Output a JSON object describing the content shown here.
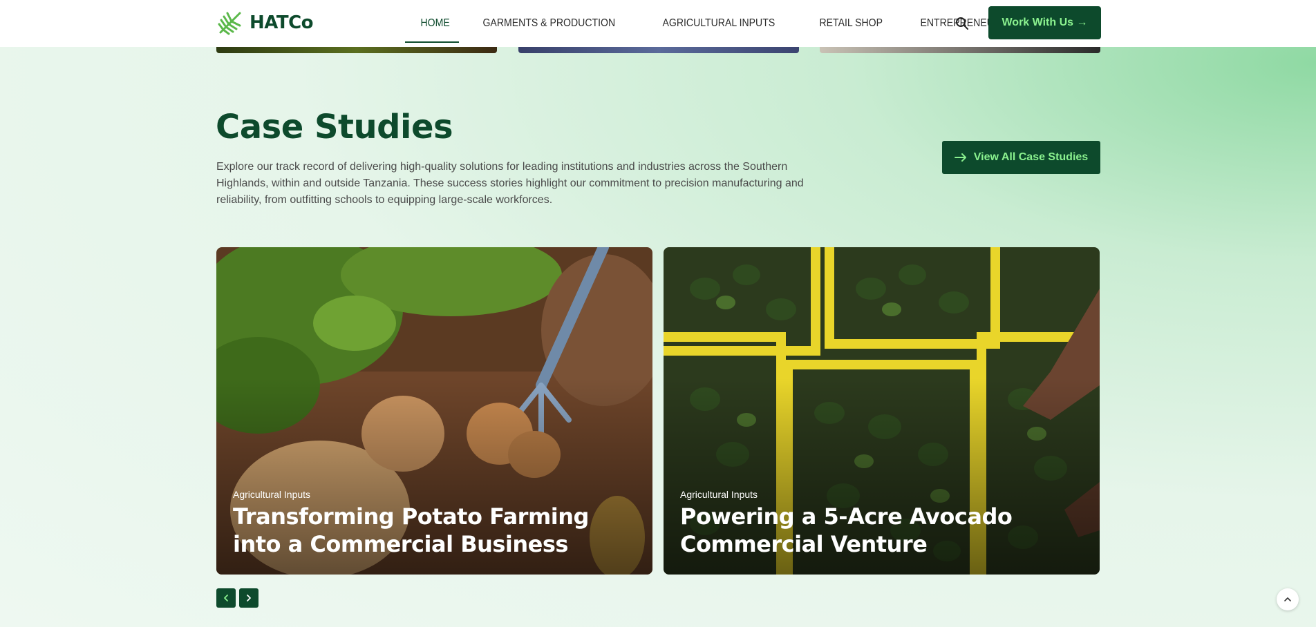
{
  "brand": {
    "name": "HATCo",
    "primary": "#0d4a2c",
    "accent": "#8bf28f"
  },
  "nav": {
    "items": [
      {
        "label": "HOME",
        "active": true
      },
      {
        "label": "GARMENTS & PRODUCTION",
        "active": false
      },
      {
        "label": "AGRICULTURAL INPUTS",
        "active": false
      },
      {
        "label": "RETAIL SHOP",
        "active": false
      },
      {
        "label": "ENTREPRENEURSHIP",
        "active": false
      }
    ],
    "search_icon": "search-icon",
    "cta_label": "Work With Us →"
  },
  "section": {
    "title": "Case Studies",
    "description": "Explore our track record of delivering high-quality solutions for leading institutions and industries across the Southern Highlands, within and outside Tanzania. These success stories highlight our commitment to precision manufacturing and reliability, from outfitting schools to equipping large-scale workforces.",
    "view_all_label": "View All Case Studies",
    "view_all_icon": "arrow-right-icon"
  },
  "cards": [
    {
      "category": "Agricultural Inputs",
      "title": "Transforming Potato Farming into a Commercial Business"
    },
    {
      "category": "Agricultural Inputs",
      "title": "Powering a 5-Acre Avocado Commercial Venture"
    }
  ],
  "slider": {
    "prev_icon": "chevron-left-icon",
    "next_icon": "chevron-right-icon"
  },
  "scroll_top_icon": "chevron-up-icon"
}
